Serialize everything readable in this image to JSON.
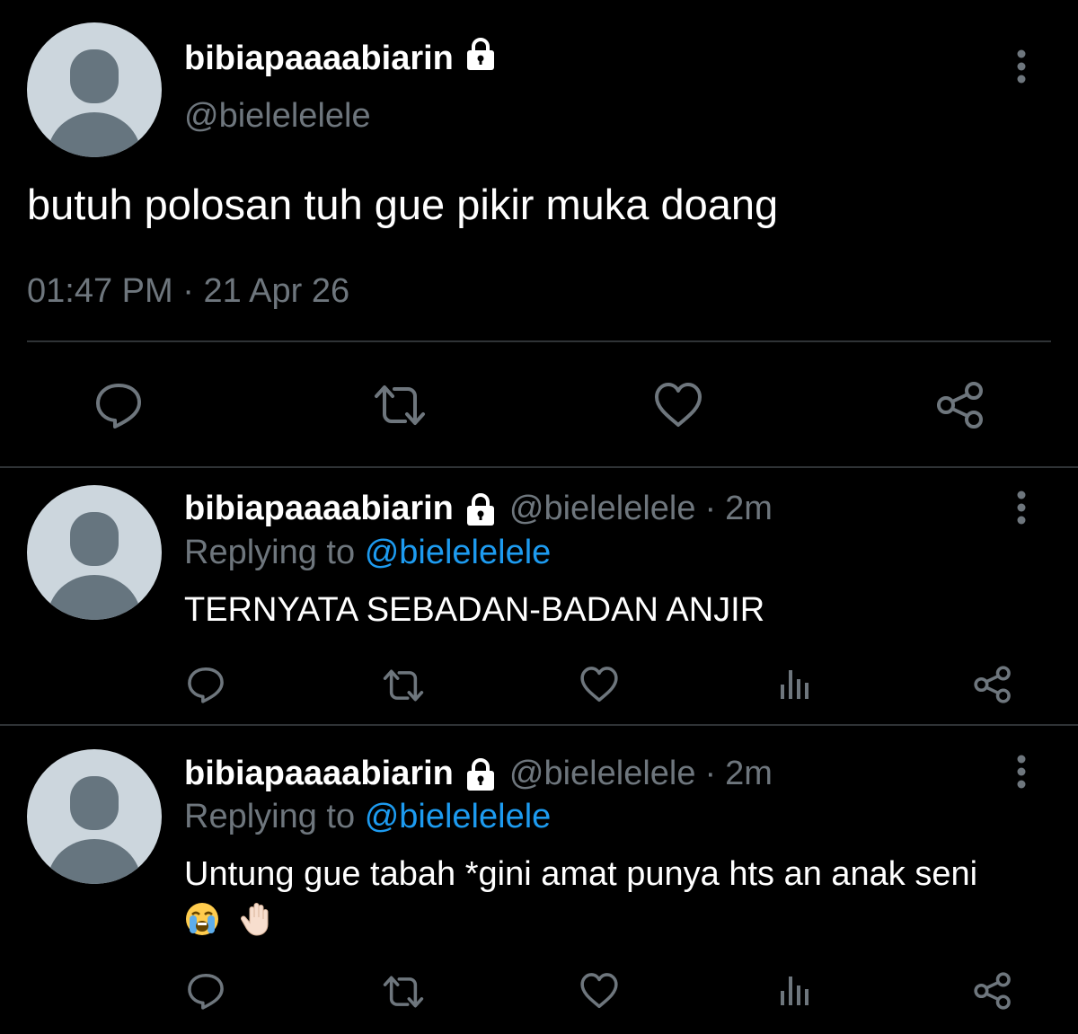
{
  "main_tweet": {
    "display_name": "bibiapaaaabiarin",
    "handle": "@bielelelele",
    "text": "butuh polosan tuh gue pikir muka doang",
    "time": "01:47 PM",
    "date": "21 Apr 26",
    "time_separator": "·",
    "actions": [
      "reply-icon",
      "retweet-icon",
      "like-icon",
      "share-icon"
    ]
  },
  "replies": [
    {
      "display_name": "bibiapaaaabiarin",
      "handle": "@bielelelele",
      "separator": "·",
      "time": "2m",
      "replying_label": "Replying to",
      "replying_to": "@bielelelele",
      "text": "TERNYATA SEBADAN-BADAN ANJIR",
      "emojis": [],
      "actions": [
        "reply-icon",
        "retweet-icon",
        "like-icon",
        "analytics-icon",
        "share-icon"
      ]
    },
    {
      "display_name": "bibiapaaaabiarin",
      "handle": "@bielelelele",
      "separator": "·",
      "time": "2m",
      "replying_label": "Replying to",
      "replying_to": "@bielelelele",
      "text": "Untung gue tabah *gini amat punya hts an anak seni",
      "emojis": [
        "crying-face-emoji",
        "raised-hand-emoji"
      ],
      "actions": [
        "reply-icon",
        "retweet-icon",
        "like-icon",
        "analytics-icon",
        "share-icon"
      ]
    }
  ],
  "colors": {
    "background": "#000000",
    "primary_text": "#ffffff",
    "secondary_text": "#6e767d",
    "mention": "#1d9bf0",
    "divider": "#2f3336",
    "avatar_bg": "#ccd6dd",
    "avatar_fg": "#66757f"
  }
}
